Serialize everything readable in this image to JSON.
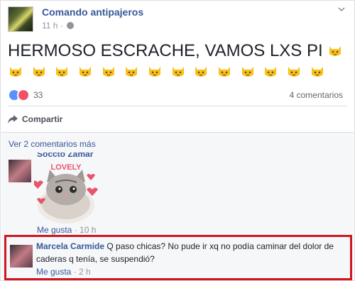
{
  "post": {
    "page_name": "Comando antipajeros",
    "time": "11 h",
    "separator": "·",
    "text": "HERMOSO ESCRACHE, VAMOS LXS PI",
    "reactions_count": "33",
    "comments_count": "4 comentarios",
    "share_label": "Compartir"
  },
  "comments": {
    "more_label": "Ver 2 comentarios más",
    "first": {
      "name": "Soccto Zamar",
      "sticker_label": "LOVELY",
      "like_label": "Me gusta",
      "separator": "·",
      "time": "10 h"
    },
    "second": {
      "name": "Marcela Carmide",
      "text": "Q paso chicas? No pude ir xq no podía caminar del dolor de caderas q tenía, se suspendió?",
      "like_label": "Me gusta",
      "separator": "·",
      "time": "2 h"
    }
  },
  "colors": {
    "link": "#365899",
    "highlight_border": "#d0161f",
    "like": "#5890ff",
    "love": "#f25268"
  },
  "icons": [
    "globe-icon",
    "chevron-down-icon",
    "cat-emoji-icon",
    "like-reaction-icon",
    "love-reaction-icon",
    "share-icon"
  ]
}
